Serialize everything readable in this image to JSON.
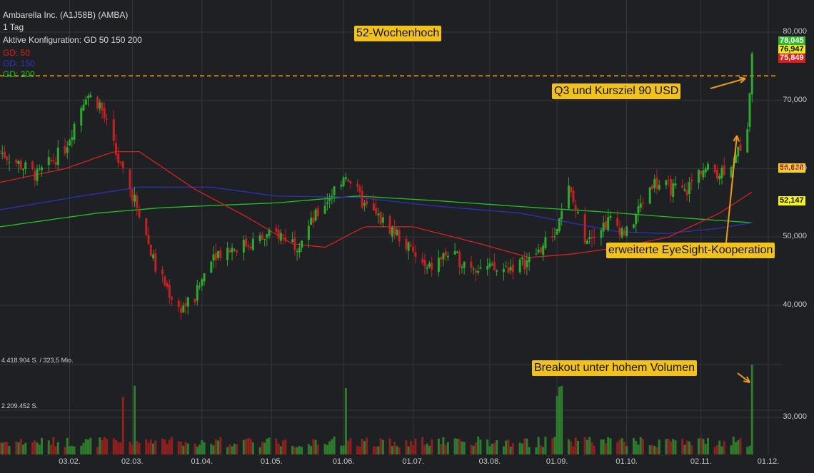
{
  "header": {
    "title": "Ambarella Inc. (A1J58B) (AMBA)",
    "interval": "1 Tag",
    "config": "Aktive Konfiguration: GD 50 150 200"
  },
  "ma_labels": [
    {
      "text": "GD: 50",
      "color": "#e02020"
    },
    {
      "text": "GD: 150",
      "color": "#2a3ac8"
    },
    {
      "text": "GD: 200",
      "color": "#20c020"
    }
  ],
  "annotations": {
    "high52": "52-Wochenhoch",
    "q3": "Q3 und Kursziel 90 USD",
    "eyesight": "erweiterte EyeSight-Kooperation",
    "breakout": "Breakout unter hohem Volumen"
  },
  "price_tags": [
    {
      "text": "78,045",
      "bg": "#2db82d",
      "fg": "#ffffff"
    },
    {
      "text": "76,947",
      "bg": "#e8e81a",
      "fg": "#111111"
    },
    {
      "text": "75,849",
      "bg": "#e01c1c",
      "fg": "#ffffff"
    },
    {
      "text": "56,638",
      "bg": "#f5d21b",
      "fg": "#b00000"
    },
    {
      "text": "52,147",
      "bg": "#f5f51b",
      "fg": "#111111"
    }
  ],
  "volume_labels": [
    "4.418.904 S. / 323,5 Mio.",
    "2.209.452 S."
  ],
  "colors": {
    "up": "#2fa82f",
    "down": "#c42121",
    "ma50": "#d42222",
    "ma150": "#2a32b8",
    "ma200": "#22c322",
    "resistance": "#ee9a1a"
  },
  "chart_data": {
    "type": "candlestick",
    "y_ticks": [
      "80,000",
      "70,000",
      "60,000",
      "50,000",
      "40,000",
      "30,000"
    ],
    "y_range": [
      29,
      80.5
    ],
    "x_ticks": [
      "03.02.",
      "02.03.",
      "01.04.",
      "01.05.",
      "01.06.",
      "01.07.",
      "03.08.",
      "01.09.",
      "01.10.",
      "02.11.",
      "01.12."
    ],
    "resistance_level": 73.6,
    "last": 76.947,
    "high": 78.045,
    "low": 75.849,
    "ma50_last": 56.638,
    "ma200_last": 52.147,
    "close_keypoints": [
      {
        "x": "2021-01-04",
        "y": 62.5
      },
      {
        "x": "2021-01-20",
        "y": 59
      },
      {
        "x": "2021-02-01",
        "y": 63
      },
      {
        "x": "2021-02-10",
        "y": 71
      },
      {
        "x": "2021-02-16",
        "y": 69.5
      },
      {
        "x": "2021-02-26",
        "y": 59
      },
      {
        "x": "2021-03-04",
        "y": 55
      },
      {
        "x": "2021-03-12",
        "y": 45.5
      },
      {
        "x": "2021-03-22",
        "y": 39.5
      },
      {
        "x": "2021-03-29",
        "y": 41
      },
      {
        "x": "2021-04-05",
        "y": 47.5
      },
      {
        "x": "2021-04-20",
        "y": 49
      },
      {
        "x": "2021-05-04",
        "y": 50.5
      },
      {
        "x": "2021-05-12",
        "y": 49
      },
      {
        "x": "2021-05-27",
        "y": 56.5
      },
      {
        "x": "2021-06-02",
        "y": 59.5
      },
      {
        "x": "2021-06-10",
        "y": 54.5
      },
      {
        "x": "2021-06-24",
        "y": 50.5
      },
      {
        "x": "2021-07-07",
        "y": 45
      },
      {
        "x": "2021-07-15",
        "y": 47.5
      },
      {
        "x": "2021-07-26",
        "y": 46
      },
      {
        "x": "2021-08-06",
        "y": 45
      },
      {
        "x": "2021-08-20",
        "y": 46.5
      },
      {
        "x": "2021-09-01",
        "y": 51
      },
      {
        "x": "2021-09-06",
        "y": 57
      },
      {
        "x": "2021-09-13",
        "y": 50
      },
      {
        "x": "2021-09-24",
        "y": 52.5
      },
      {
        "x": "2021-10-01",
        "y": 50.5
      },
      {
        "x": "2021-10-12",
        "y": 58
      },
      {
        "x": "2021-10-26",
        "y": 56.5
      },
      {
        "x": "2021-11-02",
        "y": 60
      },
      {
        "x": "2021-11-10",
        "y": 59.5
      },
      {
        "x": "2021-11-17",
        "y": 61.5
      },
      {
        "x": "2021-11-22",
        "y": 66.5
      },
      {
        "x": "2021-11-24",
        "y": 76.9
      }
    ],
    "ma50_keypoints": [
      {
        "x": "2021-01-04",
        "y": 58
      },
      {
        "x": "2021-02-01",
        "y": 60
      },
      {
        "x": "2021-02-22",
        "y": 62.5
      },
      {
        "x": "2021-03-05",
        "y": 62.5
      },
      {
        "x": "2021-03-29",
        "y": 57
      },
      {
        "x": "2021-04-20",
        "y": 53
      },
      {
        "x": "2021-05-10",
        "y": 49
      },
      {
        "x": "2021-05-24",
        "y": 48.5
      },
      {
        "x": "2021-06-10",
        "y": 51.5
      },
      {
        "x": "2021-07-01",
        "y": 51.5
      },
      {
        "x": "2021-07-30",
        "y": 49
      },
      {
        "x": "2021-08-20",
        "y": 47
      },
      {
        "x": "2021-09-07",
        "y": 47.5
      },
      {
        "x": "2021-09-28",
        "y": 48.5
      },
      {
        "x": "2021-10-19",
        "y": 50
      },
      {
        "x": "2021-11-10",
        "y": 53.5
      },
      {
        "x": "2021-11-24",
        "y": 56.6
      }
    ],
    "ma150_keypoints": [
      {
        "x": "2021-01-04",
        "y": 54
      },
      {
        "x": "2021-02-08",
        "y": 56
      },
      {
        "x": "2021-03-05",
        "y": 57.3
      },
      {
        "x": "2021-04-05",
        "y": 57.3
      },
      {
        "x": "2021-05-03",
        "y": 56
      },
      {
        "x": "2021-06-07",
        "y": 55.8
      },
      {
        "x": "2021-07-12",
        "y": 54.5
      },
      {
        "x": "2021-08-16",
        "y": 53.5
      },
      {
        "x": "2021-09-27",
        "y": 50.8
      },
      {
        "x": "2021-10-18",
        "y": 50.5
      },
      {
        "x": "2021-11-10",
        "y": 51.3
      },
      {
        "x": "2021-11-24",
        "y": 52.1
      }
    ],
    "ma200_keypoints": [
      {
        "x": "2021-01-04",
        "y": 51.5
      },
      {
        "x": "2021-02-15",
        "y": 53.5
      },
      {
        "x": "2021-03-15",
        "y": 54.3
      },
      {
        "x": "2021-05-03",
        "y": 55
      },
      {
        "x": "2021-06-07",
        "y": 56
      },
      {
        "x": "2021-07-12",
        "y": 55.3
      },
      {
        "x": "2021-08-23",
        "y": 54.3
      },
      {
        "x": "2021-09-20",
        "y": 53.7
      },
      {
        "x": "2021-10-25",
        "y": 52.8
      },
      {
        "x": "2021-11-24",
        "y": 52.1
      }
    ],
    "volume_max_shares": 4418904
  }
}
